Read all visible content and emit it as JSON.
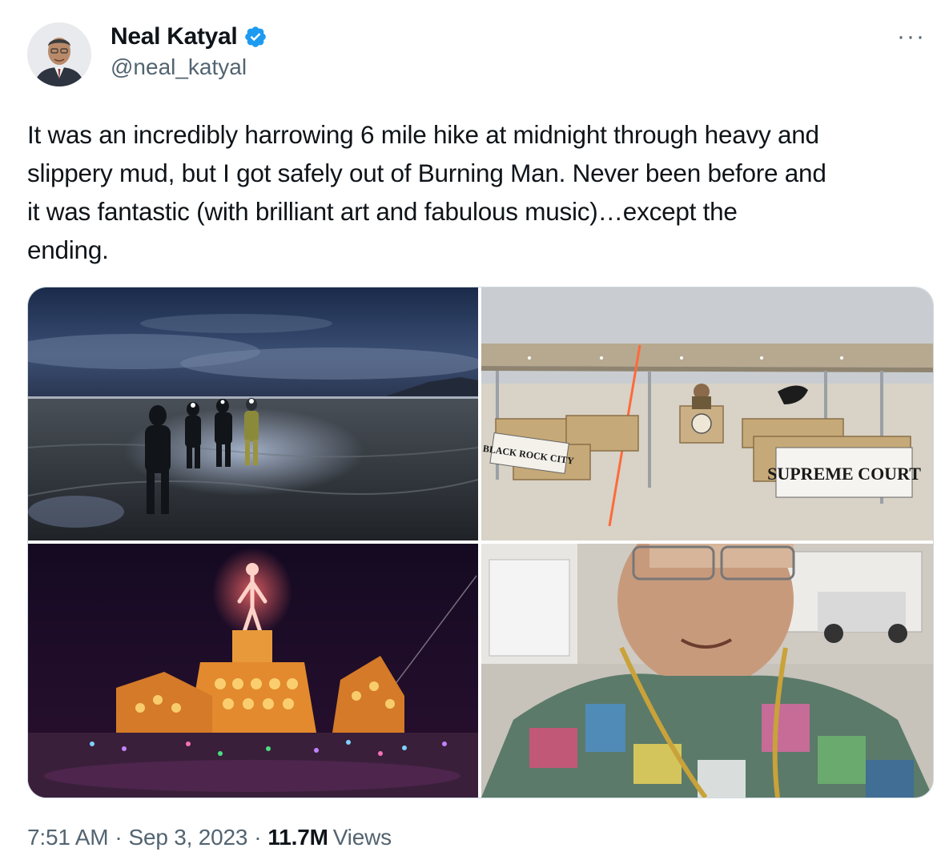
{
  "author": {
    "display_name": "Neal Katyal",
    "handle": "@neal_katyal",
    "verified": true,
    "verified_color": "#1d9bf0"
  },
  "more_label": "···",
  "tweet": {
    "text": "It was an incredibly harrowing 6 mile hike at midnight through heavy and\nslippery mud, but I got safely out of Burning Man. Never been before and\nit was fantastic (with brilliant art and fabulous music)…except the\nending."
  },
  "media": {
    "photo2": {
      "sign_left": "BLACK ROCK CITY",
      "sign_right": "SUPREME COURT"
    }
  },
  "meta": {
    "time": "7:51 AM",
    "separator": "·",
    "date": "Sep 3, 2023",
    "views_count": "11.7M",
    "views_label": "Views"
  },
  "colors": {
    "text_primary": "#0f1419",
    "text_secondary": "#536471",
    "border": "#cfd9de"
  }
}
